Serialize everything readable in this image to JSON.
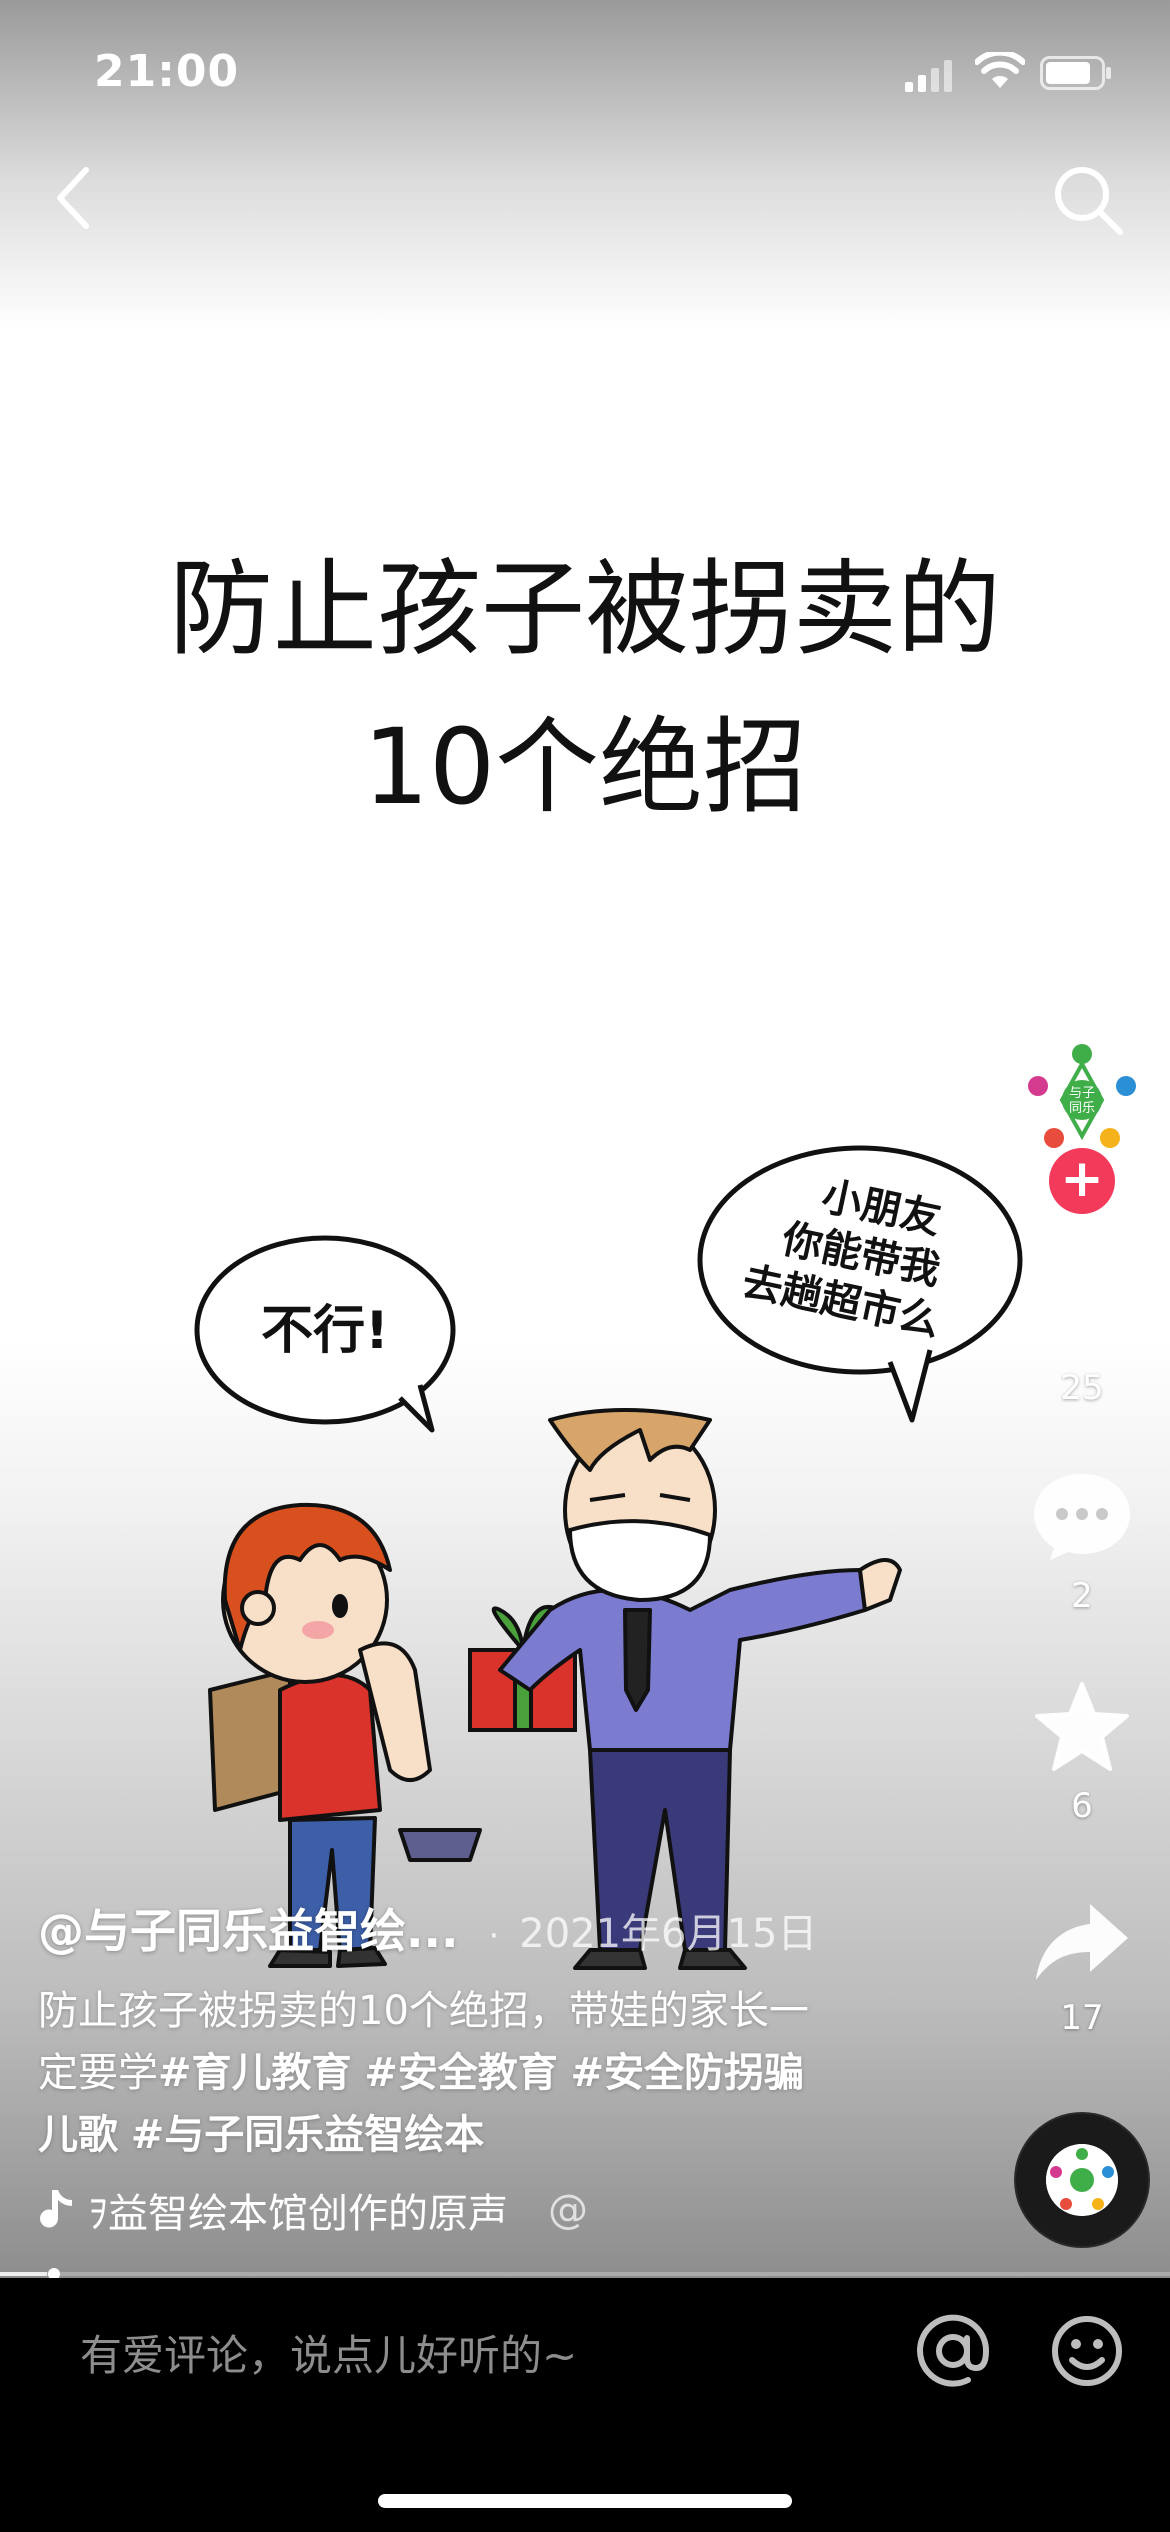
{
  "status_bar": {
    "time": "21:00"
  },
  "video": {
    "title_line1": "防止孩子被拐卖的",
    "title_line2": "10个绝招",
    "bubble_child": "不行!",
    "bubble_adult_line1": "小朋友",
    "bubble_adult_line2": "你能带我",
    "bubble_adult_line3": "去趟超市么",
    "avatar_text_line1": "与子",
    "avatar_text_line2": "同乐"
  },
  "sidebar": {
    "follow_symbol": "+",
    "like_count": "25",
    "comment_count": "2",
    "favorite_count": "6",
    "share_count": "17"
  },
  "info": {
    "author": "@与子同乐益智绘...",
    "separator": "·",
    "date": "2021年6月15日",
    "desc_text": "防止孩子被拐卖的10个绝招，带娃的家长一定要学",
    "tags": [
      "#育儿教育",
      "#安全教育",
      "#安全防拐骗儿歌",
      "#与子同乐益智绘本"
    ],
    "music": "ｦ益智绘本馆创作的原声",
    "music_mention": "@"
  },
  "progress": {
    "fraction": 0.04
  },
  "comment_bar": {
    "placeholder": "有爱评论，说点儿好听的~"
  },
  "colors": {
    "follow_red": "#f33a5a",
    "bar_bg": "#000000"
  }
}
